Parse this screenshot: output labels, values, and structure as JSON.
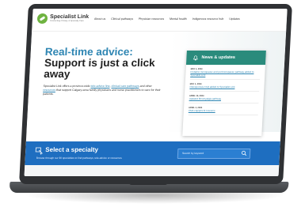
{
  "header": {
    "logo_name": "Specialist Link",
    "logo_tagline": "Connecting Primary & Specialty Care",
    "nav": [
      "About us",
      "Clinical pathways",
      "Physician resources",
      "Mental health",
      "Indigenous resource hub",
      "Updates"
    ]
  },
  "hero": {
    "title_line1": "Real-time advice:",
    "title_line2": "Support is just a click away",
    "desc_1": "Specialist Link offers a province-wide ",
    "desc_link_1": "tele-advice line",
    "desc_2": ", ",
    "desc_link_2": "clinical care pathways",
    "desc_3": " and other ",
    "desc_link_3": "resources",
    "desc_4": " that support Calgary-area family physicians and nurse practitioners to care for their patients."
  },
  "news": {
    "title": "News & updates",
    "items": [
      {
        "date": "MAY 1, 2024",
        "text": "Pediatric menopause and perimenopause pathway added to Specialist Link"
      },
      {
        "date": "MAY 1, 2024",
        "text": "Osteoporosis FAQ added to Specialist Link"
      },
      {
        "date": "APRIL 19, 2024",
        "text": "Updated fibromyalgia pathway"
      },
      {
        "date": "APRIL 3, 2024",
        "text": "CMA equipment resource"
      }
    ]
  },
  "specialty": {
    "title": "Select a specialty",
    "subtitle": "Browse through our 30 specialties to find pathways, tele-advice or resources.",
    "search_placeholder": "Search by keyword"
  },
  "colors": {
    "brand_green": "#6fb341",
    "hero_blue": "#2f86b3",
    "news_teal": "#2a8b7c",
    "band_blue": "#1e6ec0"
  }
}
